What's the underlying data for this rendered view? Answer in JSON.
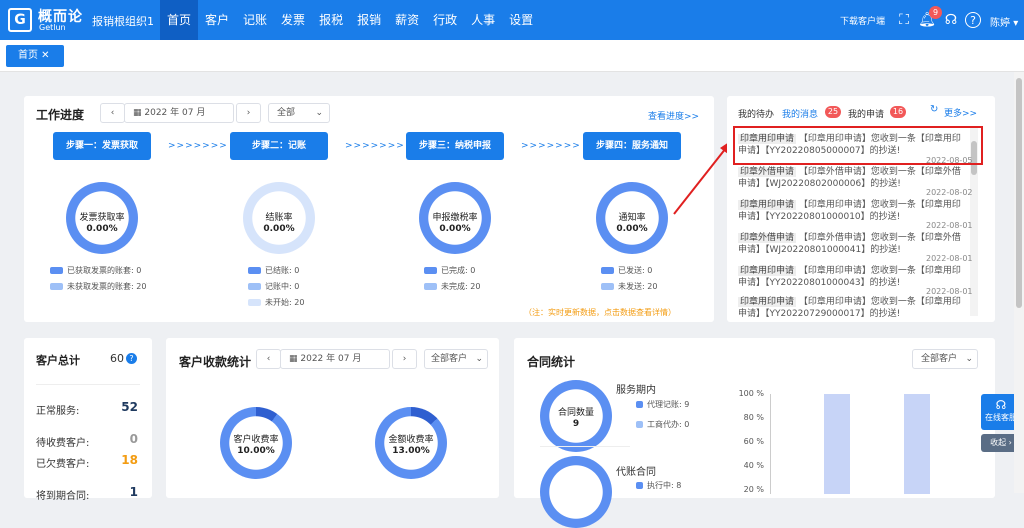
{
  "topbar": {
    "logo_mark": "G",
    "logo_name": "概而论",
    "logo_sub": "Getlun",
    "org": "报销根组织1",
    "nav": [
      "首页",
      "客户",
      "记账",
      "发票",
      "报税",
      "报销",
      "薪资",
      "行政",
      "人事",
      "设置"
    ],
    "download": "下载客户端",
    "bell_badge": "9",
    "user": "陈婷"
  },
  "tabs": {
    "home": "首页 ✕"
  },
  "progress": {
    "title": "工作进度",
    "month": "2022 年 07 月",
    "filter": "全部",
    "view_link": "查看进度>>",
    "arrow_text": ">>>>>>>",
    "steps": [
      "步骤一：发票获取",
      "步骤二：记账",
      "步骤三：纳税申报",
      "步骤四：服务通知"
    ],
    "rings": [
      {
        "label": "发票获取率",
        "value": "0.00%",
        "percent": 0,
        "legend": [
          {
            "text": "已获取发票的账套:",
            "count": "0"
          },
          {
            "text": "未获取发票的账套:",
            "count": "20"
          }
        ]
      },
      {
        "label": "结账率",
        "value": "0.00%",
        "percent": 0,
        "legend": [
          {
            "text": "已结账:",
            "count": "0"
          },
          {
            "text": "记账中:",
            "count": "0"
          },
          {
            "text": "未开始:",
            "count": "20"
          }
        ]
      },
      {
        "label": "申报缴税率",
        "value": "0.00%",
        "percent": 0,
        "legend": [
          {
            "text": "已完成:",
            "count": "0"
          },
          {
            "text": "未完成:",
            "count": "20"
          }
        ]
      },
      {
        "label": "通知率",
        "value": "0.00%",
        "percent": 0,
        "legend": [
          {
            "text": "已发送:",
            "count": "0"
          },
          {
            "text": "未发送:",
            "count": "20"
          }
        ]
      }
    ],
    "note": "（注：实时更新数据，点击数据查看详情）"
  },
  "messages": {
    "tab_todo": "我的待办",
    "tab_msg": "我的消息",
    "msg_count": "25",
    "tab_apply": "我的申请",
    "apply_count": "16",
    "more": "更多>>",
    "items": [
      {
        "tag": "印章用印申请",
        "line1": "【印章用印申请】您收到一条【印章用印",
        "line2": "申请】【YY20220805000007】的抄送!",
        "date": "2022-08-05"
      },
      {
        "tag": "印章外借申请",
        "line1": "【印章外借申请】您收到一条【印章外借",
        "line2": "申请】【WJ20220802000006】的抄送!",
        "date": "2022-08-02"
      },
      {
        "tag": "印章用印申请",
        "line1": "【印章用印申请】您收到一条【印章用印",
        "line2": "申请】【YY20220801000010】的抄送!",
        "date": "2022-08-01"
      },
      {
        "tag": "印章外借申请",
        "line1": "【印章外借申请】您收到一条【印章外借",
        "line2": "申请】【WJ20220801000041】的抄送!",
        "date": "2022-08-01"
      },
      {
        "tag": "印章用印申请",
        "line1": "【印章用印申请】您收到一条【印章用印",
        "line2": "申请】【YY20220801000043】的抄送!",
        "date": "2022-08-01"
      },
      {
        "tag": "印章用印申请",
        "line1": "【印章用印申请】您收到一条【印章用印",
        "line2": "申请】【YY20220729000017】的抄送!",
        "date": ""
      }
    ]
  },
  "customers": {
    "title": "客户总计",
    "total": "60",
    "rows": [
      {
        "label": "正常服务:",
        "value": "52",
        "color": "#1f3a5f"
      },
      {
        "label": "待收费客户:",
        "value": "0",
        "color": "#999999"
      },
      {
        "label": "已欠费客户:",
        "value": "18",
        "color": "#f39c12"
      },
      {
        "label": "将到期合同:",
        "value": "1",
        "color": "#1f3a5f"
      }
    ]
  },
  "collection": {
    "title": "客户收款统计",
    "month": "2022 年 07 月",
    "filter": "全部客户",
    "rings": [
      {
        "label": "客户收费率",
        "value": "10.00%",
        "percent": 10
      },
      {
        "label": "金额收费率",
        "value": "13.00%",
        "percent": 13
      }
    ]
  },
  "contracts": {
    "title": "合同统计",
    "filter": "全部客户",
    "ring_label": "合同数量",
    "ring_value": "9",
    "period_title": "服务期内",
    "period_legend": [
      {
        "text": "代理记账:",
        "count": "9"
      },
      {
        "text": "工商代办:",
        "count": "0"
      }
    ],
    "agency_title": "代账合同",
    "agency_legend": [
      {
        "text": "执行中:",
        "count": "8"
      }
    ]
  },
  "chart_data": {
    "type": "bar",
    "categories": [
      "",
      ""
    ],
    "values": [
      100,
      100
    ],
    "ylim": [
      0,
      100
    ],
    "yticks": [
      "100 %",
      "80 %",
      "60 %",
      "40 %",
      "20 %"
    ]
  },
  "side": {
    "service": "在线客服",
    "collapse": "收起 ›"
  },
  "colors": {
    "primary": "#1a7de9",
    "ring_full": "#5b8ff2",
    "ring_light": "#d6e4fb",
    "chart_bar": "#c7d4f7",
    "alert": "#e02020"
  }
}
